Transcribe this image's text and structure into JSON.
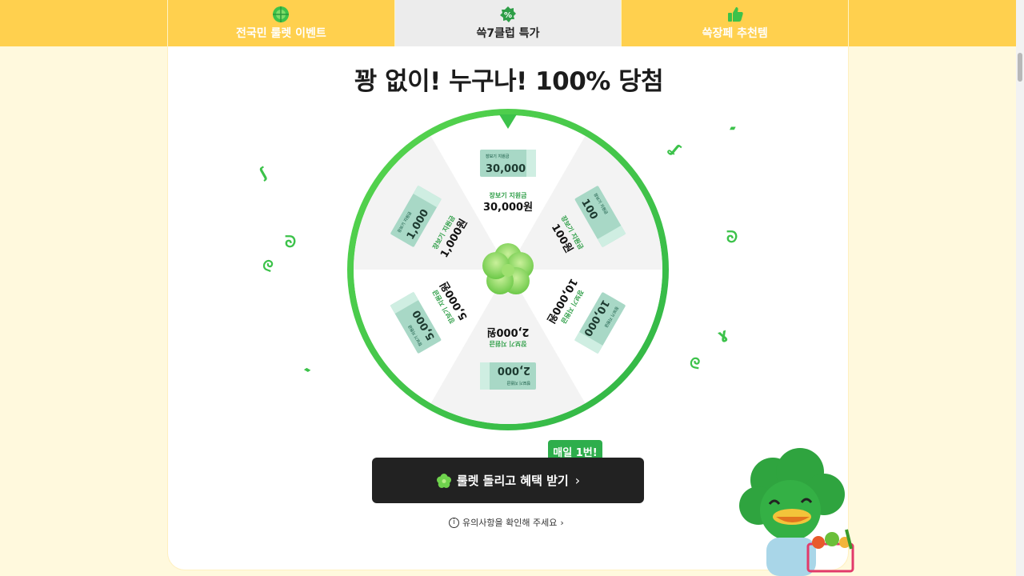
{
  "tabs": [
    {
      "label": "전국민 룰렛 이벤트",
      "icon": "roulette-icon",
      "active": false
    },
    {
      "label": "쓱7클럽 특가",
      "icon": "percent-badge-icon",
      "active": true
    },
    {
      "label": "쓱장페 추천템",
      "icon": "thumbs-up-icon",
      "active": false
    }
  ],
  "headline": "꽝 없이! 누구나! 100% 당첨",
  "wheel": {
    "segments": [
      {
        "coupon_caption": "장보기 지원금",
        "coupon_amount": "30,000",
        "prize_caption": "장보기 지원금",
        "prize_amount": "30,000원"
      },
      {
        "coupon_caption": "장보기 지원금",
        "coupon_amount": "100",
        "prize_caption": "장보기 지원금",
        "prize_amount": "100원"
      },
      {
        "coupon_caption": "장보기 지원금",
        "coupon_amount": "10,000",
        "prize_caption": "장보기 지원금",
        "prize_amount": "10,000원"
      },
      {
        "coupon_caption": "장보기 지원금",
        "coupon_amount": "2,000",
        "prize_caption": "장보기 지원금",
        "prize_amount": "2,000원"
      },
      {
        "coupon_caption": "장보기 지원금",
        "coupon_amount": "5,000",
        "prize_caption": "장보기 지원금",
        "prize_amount": "5,000원"
      },
      {
        "coupon_caption": "장보기 지원금",
        "coupon_amount": "1,000",
        "prize_caption": "장보기 지원금",
        "prize_amount": "1,000원"
      }
    ],
    "ring_color": "#3cc24a",
    "segment_colors": [
      "#ffffff",
      "#f3f3f3"
    ]
  },
  "cta": {
    "badge": "매일 1번!",
    "label": "룰렛 돌리고 혜택 받기",
    "icon": "clover-icon",
    "chevron": "chevron-right-icon"
  },
  "notice": {
    "label": "유의사항을 확인해 주세요"
  },
  "colors": {
    "accent": "#ffd04e",
    "brand_green": "#3cc24a",
    "dark_button": "#222222",
    "page_bg": "#fff9dd"
  }
}
